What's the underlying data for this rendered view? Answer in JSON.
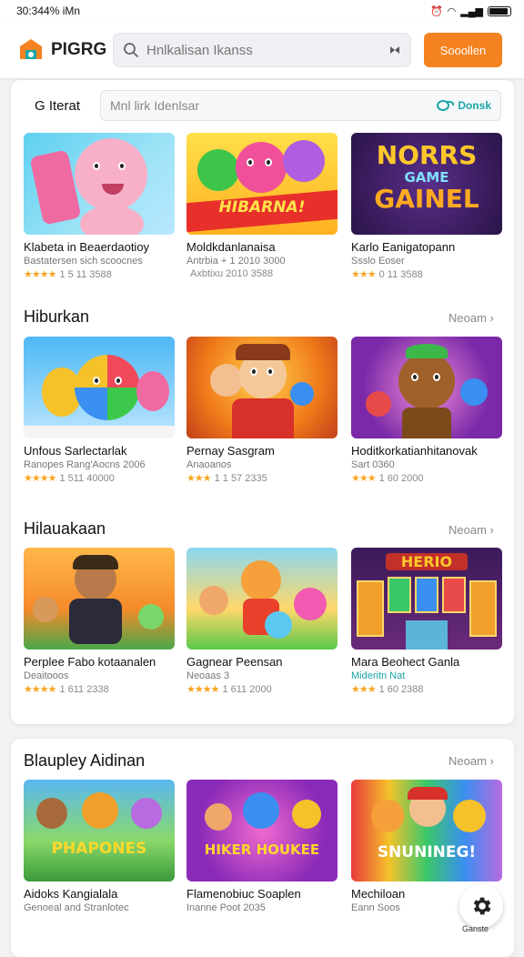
{
  "status_bar": {
    "time": "30:344% iMn"
  },
  "header": {
    "logo_text": "PIGRG",
    "search_placeholder": "Hnlkalisan Ikanss",
    "primary_button": "Sooollen"
  },
  "filter": {
    "label": "G Iterat",
    "placeholder": "Mnl lirk Idenlsar",
    "action": "Donsk"
  },
  "sections": [
    {
      "title": "",
      "see_all": "",
      "items": [
        {
          "title": "Klabeta in Beaerdaotioy",
          "subtitle": "Bastatersen sich scoocnes",
          "rating": "1 5 11 3588",
          "stars": "★★★★"
        },
        {
          "title": "Moldkdanlanaisa",
          "subtitle": "Antrbia + 1 2010 3000",
          "rating": "Axbtixu   2010 3588",
          "stars": ""
        },
        {
          "title": "Karlo Eanigatopann",
          "subtitle": "Ssslo Eoser",
          "rating": "0 11 3588",
          "stars": "★★★"
        }
      ]
    },
    {
      "title": "Hiburkan",
      "see_all": "Neoam",
      "items": [
        {
          "title": "Unfous Sarlectarlak",
          "subtitle": "Ranopes Rang'Aocns 2006",
          "rating": "1 511 40000",
          "stars": "★★★★"
        },
        {
          "title": "Pernay Sasgram",
          "subtitle": "Anaoanos",
          "rating": "1 1 57 2335",
          "stars": "★★★"
        },
        {
          "title": "Hoditkorkatianhitanovak",
          "subtitle": "Sart 0360",
          "rating": "1 60 2000",
          "stars": "★★★"
        }
      ]
    },
    {
      "title": "Hilauakaan",
      "see_all": "Neoam",
      "items": [
        {
          "title": "Perplee Fabo kotaanalen",
          "subtitle": "Deaitooos",
          "rating": "1 611 2338",
          "stars": "★★★★"
        },
        {
          "title": "Gagnear Peensan",
          "subtitle": "Neoaas 3",
          "rating": "1 611 2000",
          "stars": "★★★★"
        },
        {
          "title": "Mara Beohect Ganla",
          "subtitle": "Mideritn Nat",
          "rating": "1 60 2388",
          "stars": "★★★"
        }
      ]
    },
    {
      "title": "Blaupley Aidinan",
      "see_all": "Neoam",
      "items": [
        {
          "title": "Aidoks Kangialala",
          "subtitle": "Genoeal and Stranlotec",
          "rating": "",
          "stars": ""
        },
        {
          "title": "Flamenobiuc Soaplen",
          "subtitle": "Inanne Poot 2035",
          "rating": "",
          "stars": ""
        },
        {
          "title": "Mechiloan",
          "subtitle": "Eann Soos",
          "rating": "",
          "stars": ""
        }
      ]
    }
  ],
  "thumb_text": {
    "banner_1": "HIBARNA!",
    "banner_2": "NORRS",
    "banner_3": "GAME",
    "banner_4": "GAINEL",
    "banner_5": "HERIO",
    "banner_6": "PHAPONES",
    "banner_7": "HIKER HOUKEE",
    "banner_8": "SNUNINEG!"
  },
  "fab": {
    "label": "Ganste",
    "icon": "gear-icon"
  },
  "colors": {
    "accent": "#f58220",
    "teal": "#1aa6a6",
    "star": "#f5a623"
  }
}
